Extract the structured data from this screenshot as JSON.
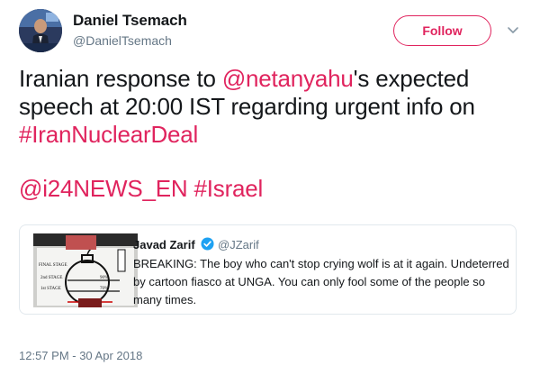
{
  "author": {
    "name": "Daniel Tsemach",
    "handle": "@DanielTsemach"
  },
  "follow_label": "Follow",
  "tweet": {
    "text_1": "Iranian response to ",
    "mention_1": "@netanyahu",
    "text_2": "'s expected speech at 20:00 IST regarding urgent info on ",
    "hashtag_1": "#IranNuclearDeal",
    "mention_2": "@i24NEWS_EN",
    "hashtag_2": "#Israel"
  },
  "quoted": {
    "name": "Javad Zarif",
    "handle": "@JZarif",
    "text": "BREAKING: The boy who can't stop crying wolf is at it again. Undeterred by cartoon fiasco at UNGA. You can only fool some of the people so many times.",
    "image_labels": {
      "final_stage": "FINAL STAGE",
      "second_stage": "2nd STAGE",
      "first_stage": "1st STAGE",
      "pct_90": "90%",
      "pct_70": "70%"
    }
  },
  "timestamp": "12:57 PM - 30 Apr 2018",
  "colors": {
    "link": "#e0245e",
    "secondary": "#657786",
    "verified": "#1da1f2"
  }
}
